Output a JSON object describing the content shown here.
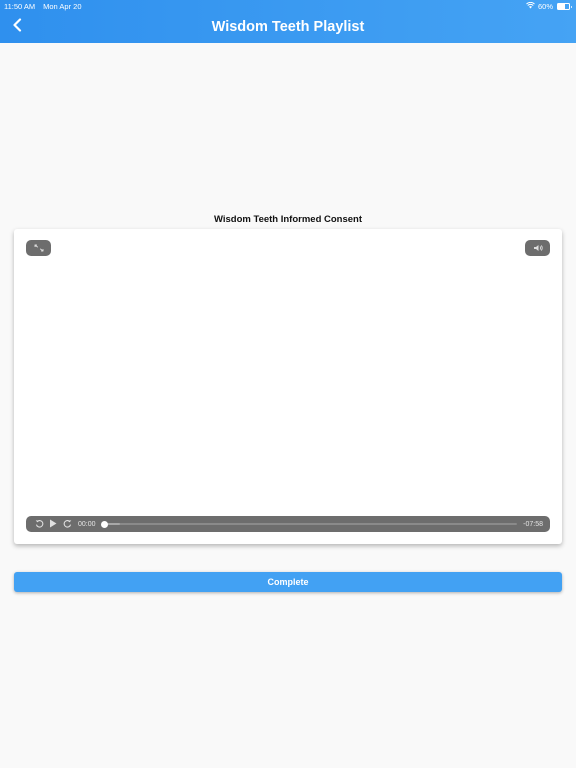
{
  "status_bar": {
    "time": "11:50 AM",
    "date": "Mon Apr 20",
    "battery": "60%",
    "battery_level": 0.6
  },
  "nav": {
    "title": "Wisdom Teeth Playlist",
    "back_icon": "chevron-left-icon"
  },
  "video": {
    "title": "Wisdom Teeth Informed Consent",
    "controls": {
      "fullscreen_icon": "fullscreen-toggle-icon",
      "volume_icon": "speaker-icon",
      "rewind_icon": "rewind-icon",
      "play_icon": "play-icon",
      "forward_icon": "fast-forward-icon",
      "elapsed": "00:00",
      "remaining": "-07:58",
      "progress": 0
    }
  },
  "actions": {
    "complete_label": "Complete"
  },
  "colors": {
    "header": "#3a9bf2",
    "accent": "#42a1f3",
    "background": "#f9f9f9",
    "control_bar": "#6d6d6d"
  }
}
